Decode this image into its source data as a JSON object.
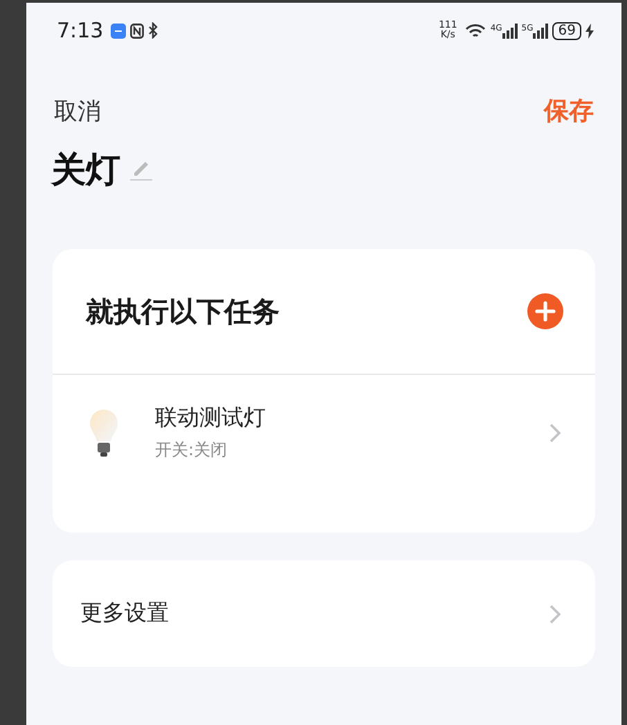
{
  "status_bar": {
    "time": "7:13",
    "speed_value": "111",
    "speed_unit": "K/s",
    "networks": [
      "4G",
      "5G"
    ],
    "battery": "69"
  },
  "nav": {
    "cancel": "取消",
    "save": "保存"
  },
  "title": "关灯",
  "task_card": {
    "heading": "就执行以下任务",
    "tasks": [
      {
        "name": "联动测试灯",
        "detail": "开关:关闭"
      }
    ]
  },
  "settings": [
    {
      "label": "更多设置"
    }
  ]
}
